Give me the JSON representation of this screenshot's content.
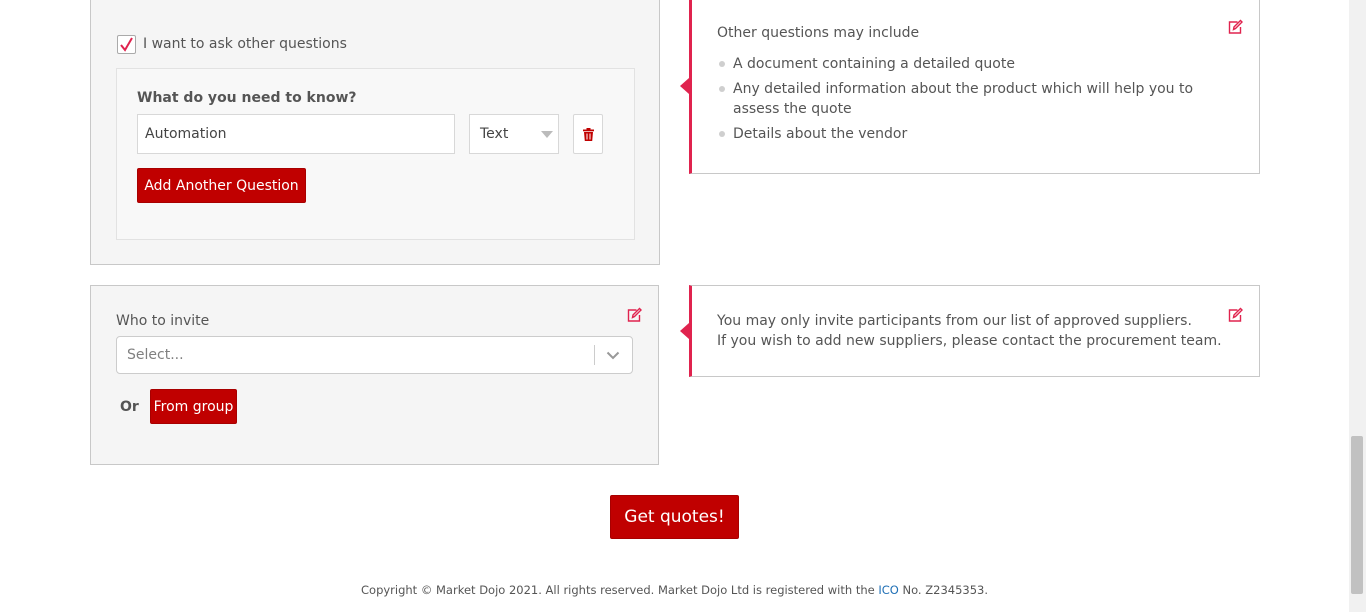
{
  "questions_panel": {
    "checkbox_label": "I want to ask other questions",
    "checked": true,
    "question_heading": "What do you need to know?",
    "question_value": "Automation",
    "type_value": "Text",
    "add_button": "Add Another Question"
  },
  "questions_hint": {
    "title": "Other questions may include",
    "items": [
      "A document containing a detailed quote",
      "Any detailed information about the product which will help you to assess the quote",
      "Details about the vendor"
    ]
  },
  "invite_panel": {
    "label": "Who to invite",
    "select_placeholder": "Select...",
    "or_text": "Or",
    "group_button": "From group"
  },
  "invite_hint": {
    "line1": "You may only invite participants from our list of approved suppliers.",
    "line2": "If you wish to add new suppliers, please contact the procurement team."
  },
  "submit_button": "Get quotes!",
  "footer": {
    "text_before": "Copyright © Market Dojo 2021. All rights reserved. Market Dojo Ltd is registered with the",
    "link": "ICO",
    "text_after": "No. Z2345353."
  },
  "colors": {
    "accent": "#c00000",
    "highlight": "#e0234e",
    "link": "#1f6fb5"
  },
  "icons": [
    "checkmark-icon",
    "dropdown-caret-icon",
    "trash-icon",
    "edit-icon",
    "chevron-down-icon"
  ]
}
